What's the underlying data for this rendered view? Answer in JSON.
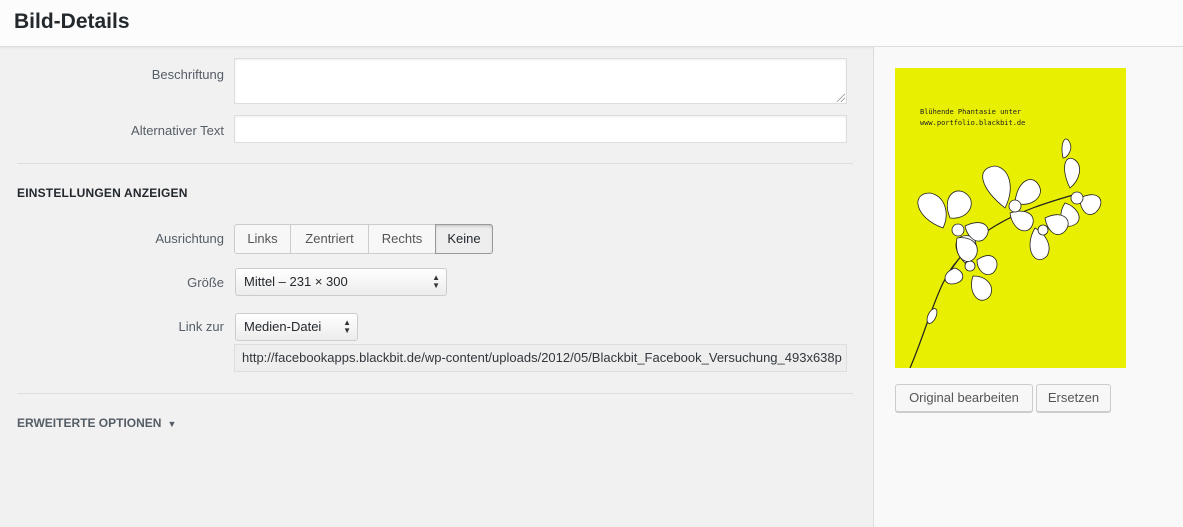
{
  "header": {
    "title": "Bild-Details"
  },
  "fields": {
    "caption_label": "Beschriftung",
    "caption_value": "",
    "alt_label": "Alternativer Text",
    "alt_value": ""
  },
  "display_settings": {
    "title": "Einstellungen anzeigen",
    "align_label": "Ausrichtung",
    "align_options": [
      "Links",
      "Zentriert",
      "Rechts",
      "Keine"
    ],
    "align_selected": "Keine",
    "size_label": "Größe",
    "size_value": "Mittel – 231 × 300",
    "link_label": "Link zur",
    "link_value": "Medien-Datei",
    "url_value": "http://facebookapps.blackbit.de/wp-content/uploads/2012/05/Blackbit_Facebook_Versuchung_493x638p"
  },
  "advanced": {
    "label": "Erweiterte Optionen"
  },
  "preview": {
    "text_line1": "Blühende Phantasie unter",
    "text_line2": "www.portfolio.blackbit.de",
    "background": "#e9ef00",
    "edit_button": "Original bearbeiten",
    "replace_button": "Ersetzen"
  }
}
